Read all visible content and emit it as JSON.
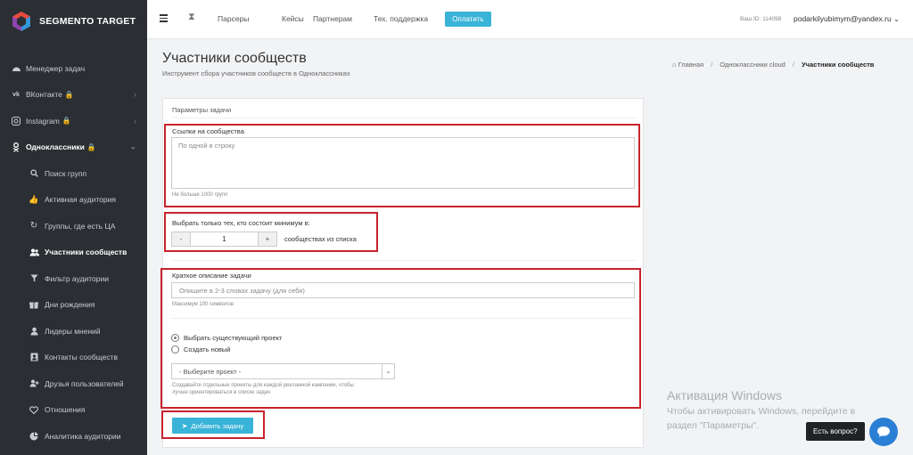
{
  "logo": {
    "text": "SEGMENTO TARGET"
  },
  "sidebar": {
    "items": [
      {
        "label": "Менеджер задач",
        "icon": "dashboard-icon"
      },
      {
        "label": "ВКонтакте",
        "icon": "vk-icon",
        "locked": true
      },
      {
        "label": "Instagram",
        "icon": "instagram-icon",
        "locked": true
      },
      {
        "label": "Одноклассники",
        "icon": "odnoklassniki-icon",
        "locked": true
      }
    ],
    "subitems": [
      {
        "label": "Поиск групп",
        "icon": "search-icon"
      },
      {
        "label": "Активная аудитория",
        "icon": "thumbs-up-icon"
      },
      {
        "label": "Группы, где есть ЦА",
        "icon": "refresh-icon"
      },
      {
        "label": "Участники сообществ",
        "icon": "users-icon"
      },
      {
        "label": "Фильтр аудитории",
        "icon": "filter-icon"
      },
      {
        "label": "Дни рождения",
        "icon": "gift-icon"
      },
      {
        "label": "Лидеры мнений",
        "icon": "user-icon"
      },
      {
        "label": "Контакты сообществ",
        "icon": "contact-icon"
      },
      {
        "label": "Друзья пользователей",
        "icon": "user-plus-icon"
      },
      {
        "label": "Отношения",
        "icon": "heart-icon"
      },
      {
        "label": "Аналитика аудитории",
        "icon": "chart-icon"
      }
    ]
  },
  "topbar": {
    "links": [
      "Парсеры",
      "Кейсы",
      "Партнерам",
      "Тех. поддержка"
    ],
    "pay_label": "Оплатить",
    "uid": "Ваш ID: 114098",
    "email": "podarkilyubimym@yandex.ru"
  },
  "header": {
    "title": "Участники сообществ",
    "subtitle": "Инструмент сбора участников сообществ в Одноклассниках",
    "breadcrumb": [
      "Главная",
      "Одноклассники cloud",
      "Участники сообществ"
    ]
  },
  "form": {
    "panel_title": "Параметры задачи",
    "links_label": "Ссылки на сообщества",
    "links_placeholder": "По одной в строку",
    "links_hint": "Не больше 1000 групп",
    "min_label": "Выбрать только тех, кто состоит минимум в:",
    "min_minus": "-",
    "min_value": "1",
    "min_plus": "+",
    "min_suffix": "сообществах из списка",
    "desc_label": "Краткое описание задачи",
    "desc_placeholder": "Опишите в 2-3 словах задачу (для себя)",
    "desc_hint": "Максимум 100 символов",
    "radio_existing": "Выбрать существующий проект",
    "radio_new": "Создать новый",
    "project_select": "- Выберите проект -",
    "project_hint_1": "Создавайте отдельные проекты для каждой рекламной кампании, чтобы",
    "project_hint_2": "лучше ориентироваться в списке задач",
    "submit_label": "Добавить задачу"
  },
  "watermark": {
    "title": "Активация Windows",
    "line1": "Чтобы активировать Windows, перейдите в",
    "line2": "раздел \"Параметры\"."
  },
  "help": {
    "label": "Есть вопрос?"
  },
  "colors": {
    "accent": "#39b3d7",
    "sidebar": "#2b2f33",
    "highlight": "#c8232c"
  }
}
